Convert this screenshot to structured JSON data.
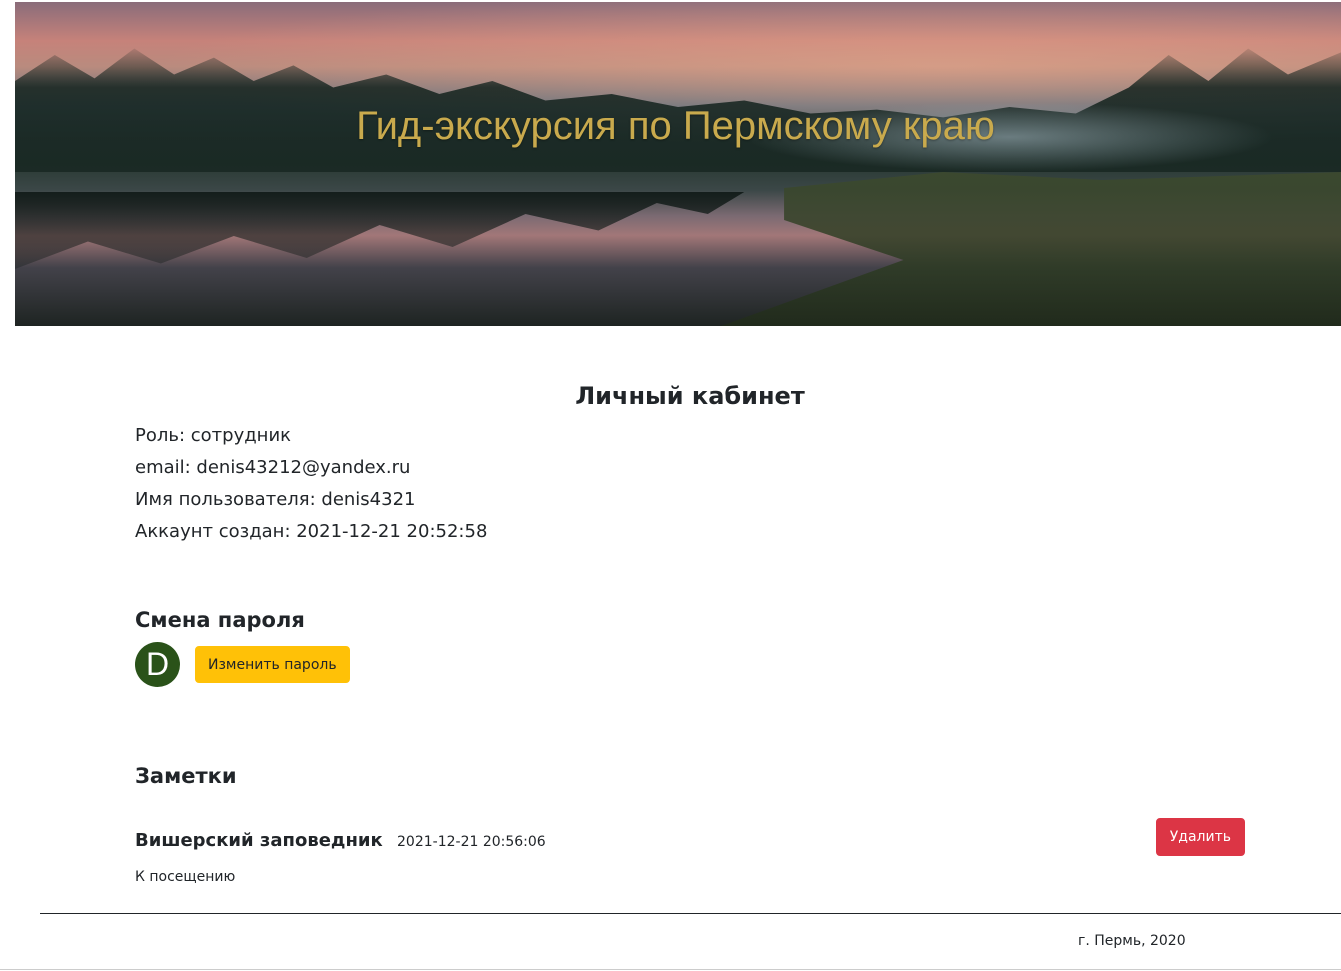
{
  "header": {
    "title": "Гид-экскурсия по Пермскому краю"
  },
  "profile": {
    "page_title": "Личный кабинет",
    "role": "Роль: сотрудник",
    "email": "email: denis43212@yandex.ru",
    "username": "Имя пользователя: denis4321",
    "created": "Аккаунт создан: 2021-12-21 20:52:58"
  },
  "password": {
    "section_title": "Смена пароля",
    "avatar_letter": "D",
    "avatar_color": "#2a5219",
    "change_button": "Изменить пароль"
  },
  "notes": {
    "section_title": "Заметки",
    "items": [
      {
        "title": "Вишерский заповедник",
        "date": "2021-12-21 20:56:06",
        "text": "К посещению",
        "delete_label": "Удалить"
      }
    ]
  },
  "footer": {
    "text": "г. Пермь, 2020"
  },
  "colors": {
    "title_gold": "#c9aa4d",
    "warning": "#ffc107",
    "danger": "#dc3545"
  }
}
